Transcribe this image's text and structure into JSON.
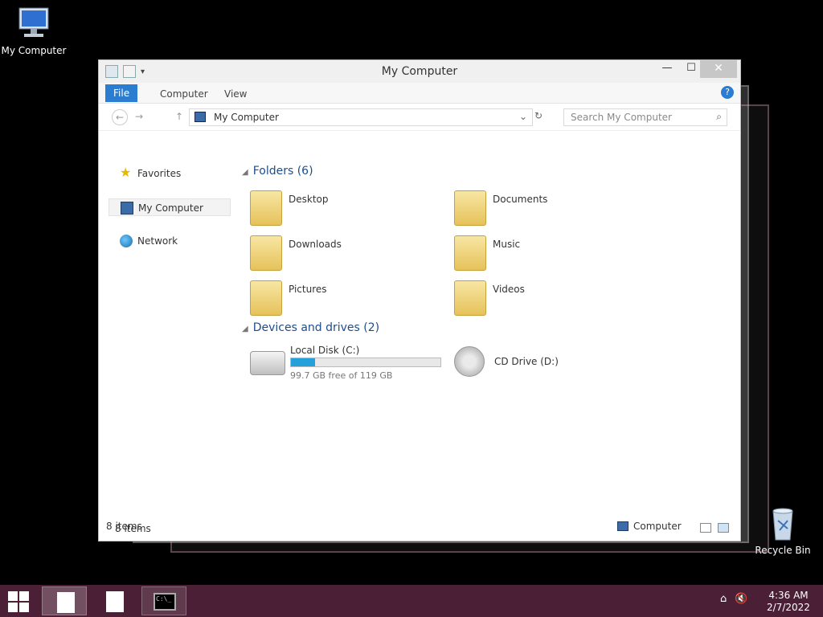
{
  "desktop": {
    "icons": [
      {
        "label": "My Computer",
        "icon": "computer-icon"
      },
      {
        "label": "Recycle Bin",
        "icon": "recycle-bin-icon"
      }
    ]
  },
  "window": {
    "title": "My Computer",
    "quick_access": [
      "properties-icon",
      "new-folder-icon",
      "customize-icon"
    ],
    "ribbon_tabs": [
      {
        "label": "File",
        "active": true
      },
      {
        "label": "Computer",
        "active": false
      },
      {
        "label": "View",
        "active": false
      }
    ],
    "address": "My Computer",
    "search_placeholder": "Search My Computer",
    "sidebar": [
      {
        "label": "Favorites",
        "icon": "star-icon",
        "selected": false
      },
      {
        "label": "My Computer",
        "icon": "computer-icon",
        "selected": true
      },
      {
        "label": "Network",
        "icon": "network-icon",
        "selected": false
      }
    ],
    "groups": {
      "folders": {
        "title": "Folders (6)"
      },
      "drives": {
        "title": "Devices and drives (2)"
      }
    },
    "folders": [
      {
        "label": "Desktop"
      },
      {
        "label": "Documents"
      },
      {
        "label": "Downloads"
      },
      {
        "label": "Music"
      },
      {
        "label": "Pictures"
      },
      {
        "label": "Videos"
      }
    ],
    "drives": [
      {
        "label": "Local Disk (C:)",
        "free_text": "99.7 GB free of 119 GB",
        "used_fraction": 0.16
      },
      {
        "label": "CD Drive (D:)"
      }
    ],
    "status": {
      "count": "8 items"
    }
  },
  "outer_status": {
    "count": "8 items",
    "location": "Computer"
  },
  "taskbar": {
    "time": "4:36 AM",
    "date": "2/7/2022",
    "accent": "#4b1f35"
  }
}
